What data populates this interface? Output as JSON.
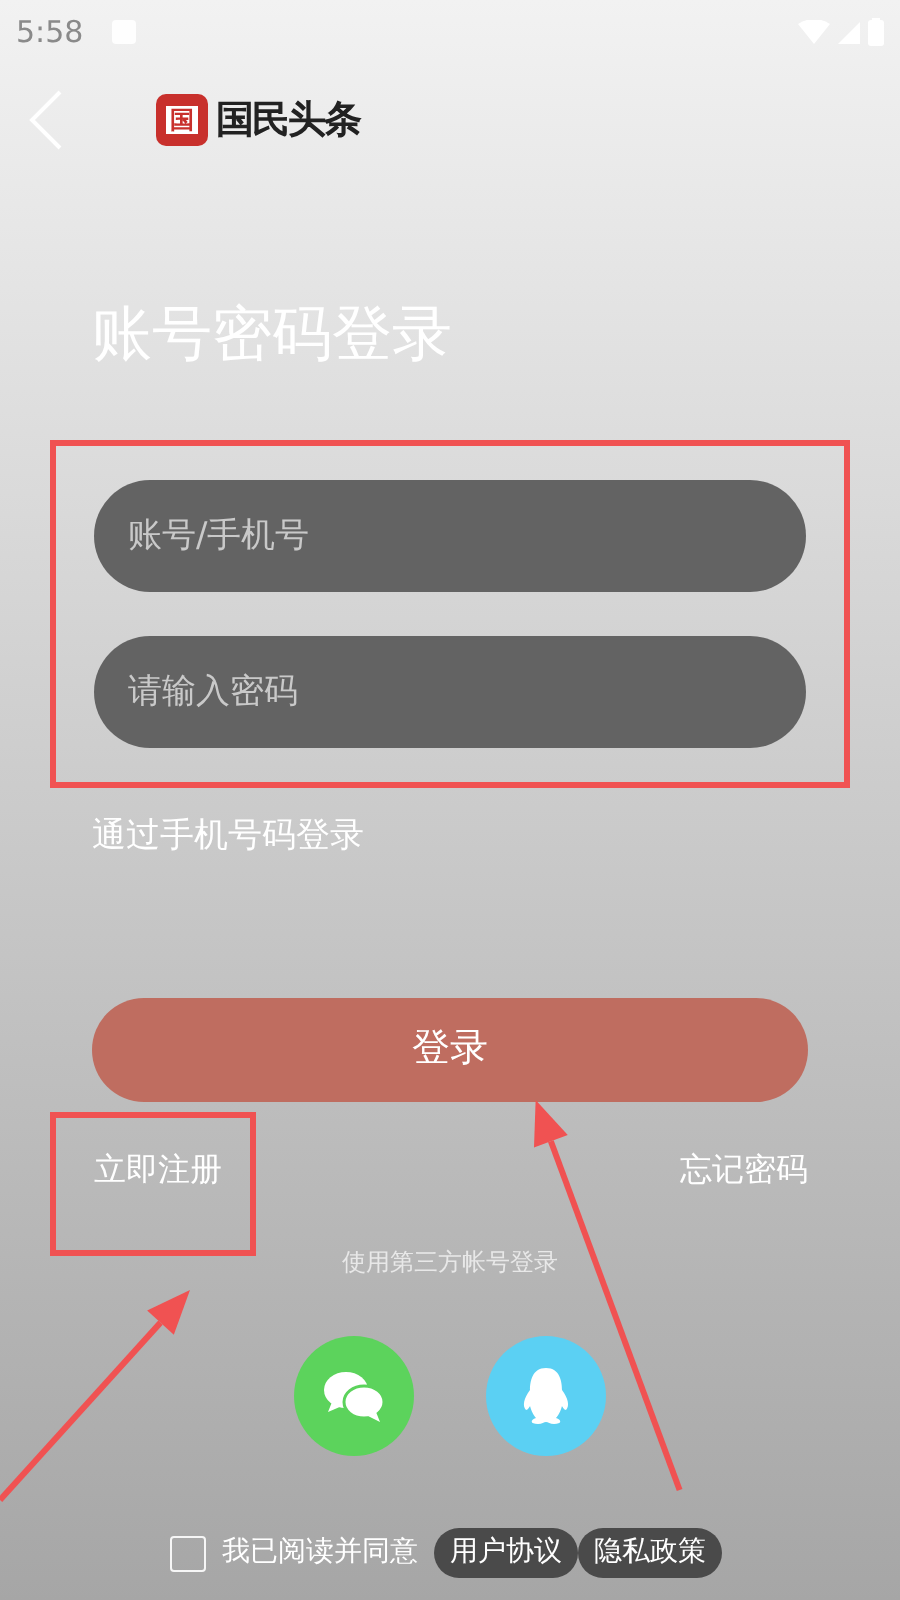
{
  "status_bar": {
    "time": "5:58"
  },
  "header": {
    "logo_mark": "国",
    "logo_text": "国民头条"
  },
  "title": "账号密码登录",
  "fields": [
    {
      "placeholder": "账号/手机号"
    },
    {
      "placeholder": "请输入密码"
    }
  ],
  "phone_login_link": "通过手机号码登录",
  "login_button": "登录",
  "register_link": "立即注册",
  "forgot_link": "忘记密码",
  "third_party": {
    "label": "使用第三方帐号登录",
    "options": [
      {
        "kind": "wechat",
        "color": "#5cd35c"
      },
      {
        "kind": "qq",
        "color": "#5bd0f3"
      }
    ]
  },
  "agreement": {
    "checked": false,
    "text": "我已阅读并同意",
    "links": [
      "用户协议",
      "隐私政策"
    ]
  },
  "annotations": [
    {
      "kind": "box"
    },
    {
      "kind": "box"
    },
    {
      "kind": "arrow"
    },
    {
      "kind": "arrow"
    }
  ]
}
